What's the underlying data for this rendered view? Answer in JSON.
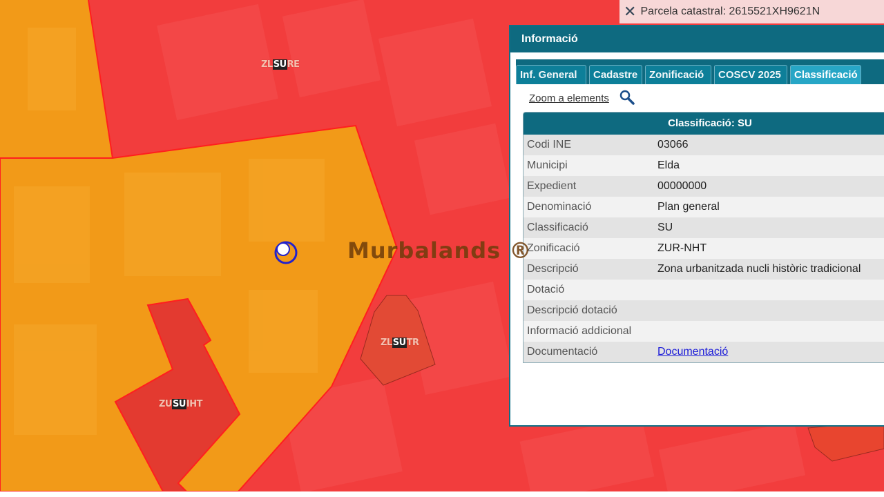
{
  "map": {
    "zone_labels": [
      {
        "id": "zlsure",
        "left": "ZL",
        "mid": "SU",
        "right": "RE"
      },
      {
        "id": "zlsutr",
        "left": "ZL",
        "mid": "SU",
        "right": "TR"
      },
      {
        "id": "zusuiht",
        "left": "ZU",
        "mid": "SU",
        "right": "IHT"
      }
    ],
    "colors": {
      "urban": "#f03c3c",
      "orange": "#f09a1a",
      "dark_red": "#e03432"
    }
  },
  "watermark": "Murbalands ®",
  "parcel_bar": {
    "close_icon": "close-icon",
    "text": "Parcela catastral: 2615521XH9621N"
  },
  "panel": {
    "title": "Informació",
    "tabs": [
      {
        "label": "Inf. General",
        "active": false
      },
      {
        "label": "Cadastre",
        "active": false
      },
      {
        "label": "Zonificació",
        "active": false
      },
      {
        "label": "COSCV 2025",
        "active": false
      },
      {
        "label": "Classificació",
        "active": true
      }
    ],
    "zoom_link": "Zoom a elements",
    "zoom_icon": "search-icon",
    "table": {
      "header_prefix": "Classificació: ",
      "header_value": "SU",
      "rows": [
        {
          "key": "Codi INE",
          "value": "03066"
        },
        {
          "key": "Municipi",
          "value": "Elda"
        },
        {
          "key": "Expedient",
          "value": "00000000"
        },
        {
          "key": "Denominació",
          "value": "Plan general"
        },
        {
          "key": "Classificació",
          "value": "SU"
        },
        {
          "key": "Zonificació",
          "value": "ZUR-NHT"
        },
        {
          "key": "Descripció",
          "value": "Zona urbanitzada nucli històric tradicional"
        },
        {
          "key": "Dotació",
          "value": ""
        },
        {
          "key": "Descripció dotació",
          "value": ""
        },
        {
          "key": "Informació addicional",
          "value": ""
        },
        {
          "key": "Documentació",
          "value": "Documentació",
          "link": true
        }
      ]
    }
  }
}
